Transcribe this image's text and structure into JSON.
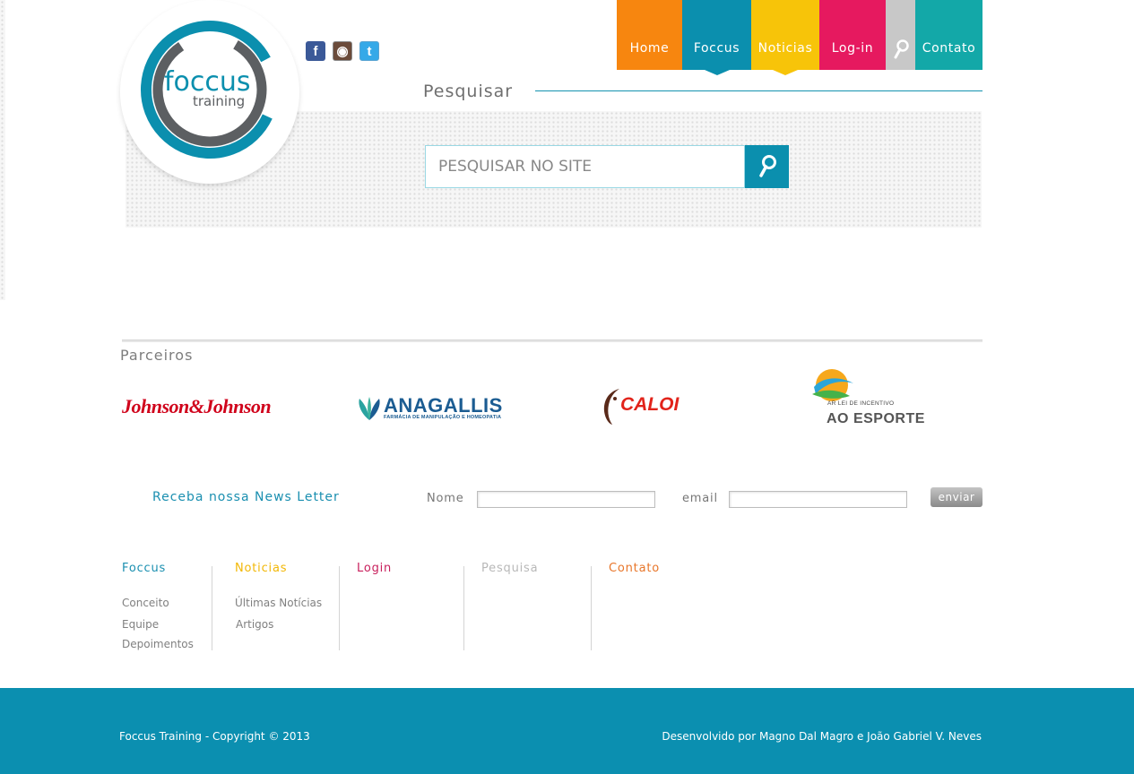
{
  "brand": {
    "logo_main": "foccus",
    "logo_sub": "training",
    "colors": {
      "teal": "#0b8fae",
      "gray": "#5c5f62"
    }
  },
  "social": [
    {
      "name": "facebook-icon",
      "glyph": "f"
    },
    {
      "name": "instagram-icon",
      "glyph": "◉"
    },
    {
      "name": "twitter-icon",
      "glyph": "t"
    }
  ],
  "nav": {
    "items": [
      {
        "label": "Home",
        "color": "#f7860f"
      },
      {
        "label": "Foccus",
        "color": "#0b8fae"
      },
      {
        "label": "Noticias",
        "color": "#f7c409"
      },
      {
        "label": "Log-in",
        "color": "#e6195f"
      },
      {
        "label": "",
        "icon": "search-icon",
        "color": "#c8c8c8"
      },
      {
        "label": "Contato",
        "color": "#13a8a8"
      }
    ]
  },
  "search": {
    "title": "Pesquisar",
    "placeholder": "PESQUISAR NO SITE",
    "button_icon": "search-icon"
  },
  "partners": {
    "title": "Parceiros",
    "items": [
      {
        "name": "Johnson&Johnson"
      },
      {
        "name": "ANAGALLIS",
        "subtitle": "FARMÁCIA DE MANIPULAÇÃO E HOMEOPATIA"
      },
      {
        "name": "CALOI"
      },
      {
        "name": "AO ESPORTE",
        "subtitle": "AR LEI DE INCENTIVO"
      }
    ]
  },
  "newsletter": {
    "title": "Receba nossa News Letter",
    "name_label": "Nome",
    "email_label": "email",
    "submit_label": "enviar"
  },
  "footer_nav": [
    {
      "title": "Foccus",
      "color": "#1a8fb0",
      "links": [
        "Conceito",
        "Equipe",
        "Depoimentos"
      ]
    },
    {
      "title": "Noticias",
      "color": "#f2b705",
      "links": [
        "Últimas Notícias",
        "Artigos"
      ]
    },
    {
      "title": "Login",
      "color": "#c81f5c",
      "links": []
    },
    {
      "title": "Pesquisa",
      "color": "#b8b8b8",
      "links": []
    },
    {
      "title": "Contato",
      "color": "#e8762a",
      "links": []
    }
  ],
  "footer": {
    "copyright": "Foccus Training - Copyright © 2013",
    "developed_by": "Desenvolvido por Magno Dal Magro e João Gabriel V. Neves"
  }
}
